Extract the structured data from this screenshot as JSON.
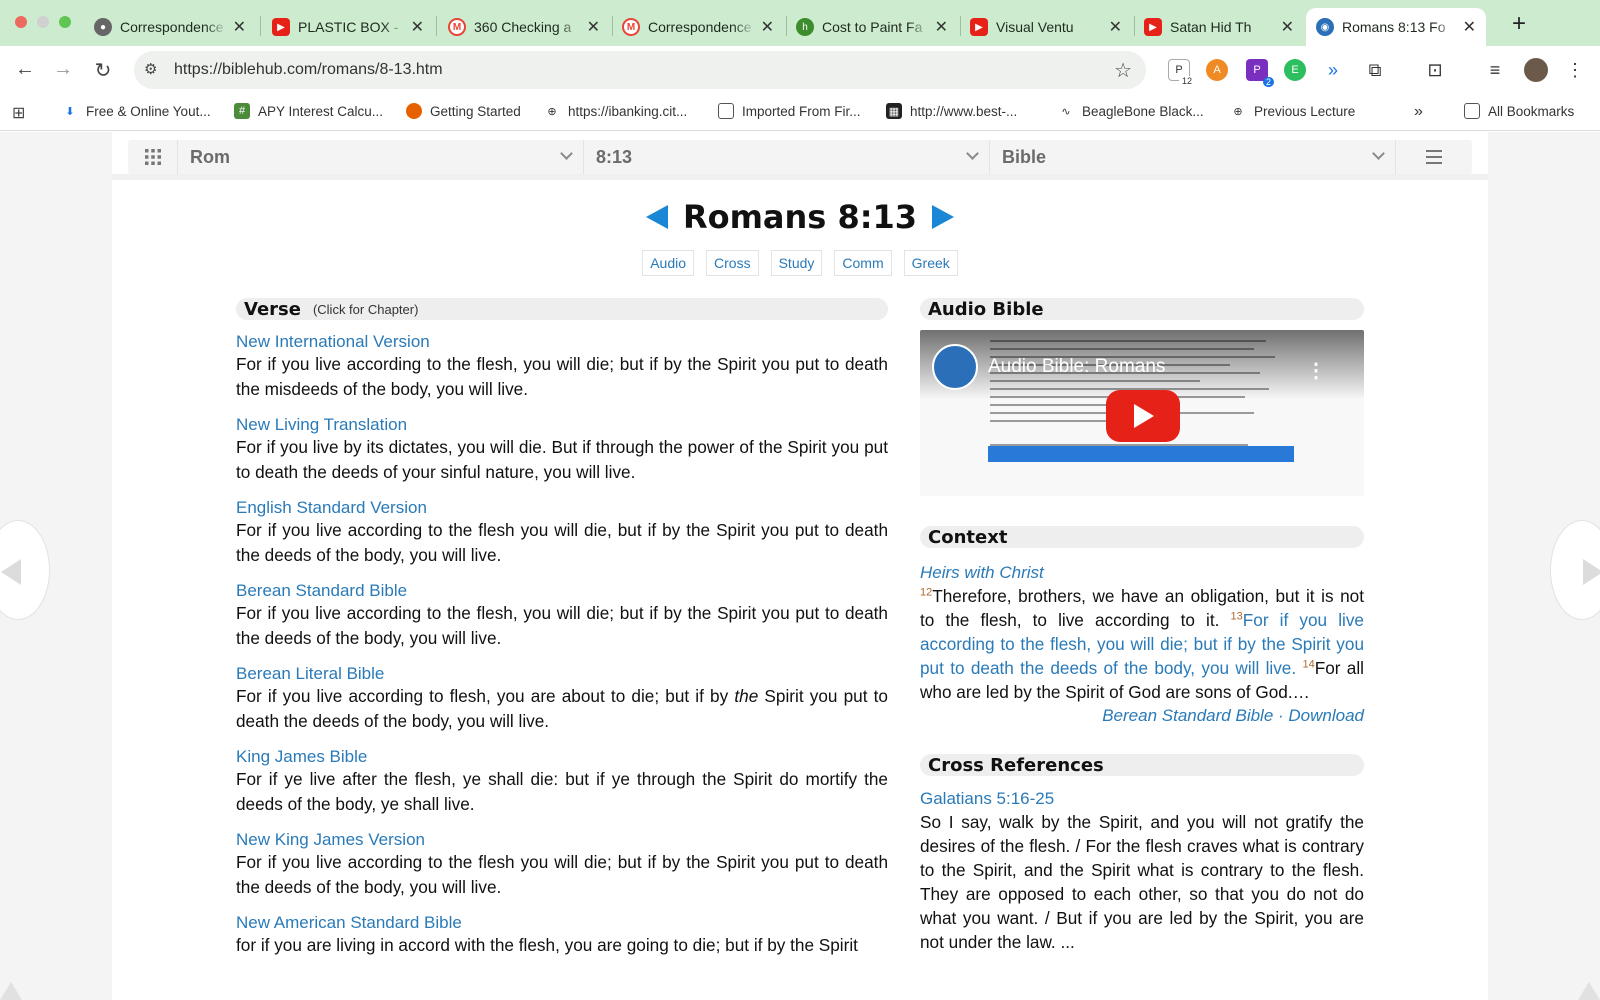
{
  "browser": {
    "tabs": [
      {
        "title": "Correspondence",
        "icon": "globe-icon"
      },
      {
        "title": "PLASTIC BOX -",
        "icon": "youtube-icon"
      },
      {
        "title": "360 Checking a",
        "icon": "gmail-icon"
      },
      {
        "title": "Correspondence",
        "icon": "gmail-icon"
      },
      {
        "title": "Cost to Paint Fa",
        "icon": "homeguide-icon"
      },
      {
        "title": "Visual Ventu",
        "icon": "youtube-icon"
      },
      {
        "title": "Satan Hid Th",
        "icon": "youtube-icon"
      },
      {
        "title": "Romans 8:13 Fo",
        "icon": "biblehub-icon"
      }
    ],
    "url": "https://biblehub.com/romans/8-13.htm",
    "extensions": [
      {
        "icon": "extension-badge-icon",
        "badge": "12"
      },
      {
        "icon": "avast-icon",
        "badge": ""
      },
      {
        "icon": "purple-p-icon",
        "badge": "2"
      },
      {
        "icon": "evernote-icon",
        "badge": ""
      },
      {
        "icon": "audio-wave-icon",
        "badge": ""
      }
    ],
    "bookmarks": [
      {
        "label": "Free & Online Yout...",
        "icon": "download-icon"
      },
      {
        "label": "APY Interest Calcu...",
        "icon": "calculator-icon"
      },
      {
        "label": "Getting Started",
        "icon": "firefox-icon"
      },
      {
        "label": "https://ibanking.cit...",
        "icon": "globe-icon"
      },
      {
        "label": "Imported From Fir...",
        "icon": "folder-icon"
      },
      {
        "label": "http://www.best-...",
        "icon": "site-icon"
      },
      {
        "label": "BeagleBone Black...",
        "icon": "wave-icon"
      },
      {
        "label": "Previous Lecture",
        "icon": "globe-icon"
      }
    ],
    "all_bookmarks": "All Bookmarks",
    "more_bookmarks": "»"
  },
  "selectors": {
    "book": "Rom",
    "verse": "8:13",
    "version": "Bible"
  },
  "header": {
    "title": "Romans 8:13",
    "subnav": [
      "Audio",
      "Cross",
      "Study",
      "Comm",
      "Greek"
    ]
  },
  "verse_section": {
    "title": "Verse",
    "subtitle": "(Click for Chapter)",
    "versions": [
      {
        "name": "New International Version",
        "text": "For if you live according to the flesh, you will die; but if by the Spirit you put to death the misdeeds of the body, you will live."
      },
      {
        "name": "New Living Translation",
        "text": "For if you live by its dictates, you will die. But if through the power of the Spirit you put to death the deeds of your sinful nature, you will live."
      },
      {
        "name": "English Standard Version",
        "text": "For if you live according to the flesh you will die, but if by the Spirit you put to death the deeds of the body, you will live."
      },
      {
        "name": "Berean Standard Bible",
        "text": "For if you live according to the flesh, you will die; but if by the Spirit you put to death the deeds of the body, you will live."
      },
      {
        "name": "Berean Literal Bible",
        "text_before": "For if you live according to flesh, you are about to die; but if by ",
        "text_italic": "the",
        "text_after": " Spirit you put to death the deeds of the body, you will live."
      },
      {
        "name": "King James Bible",
        "text": "For if ye live after the flesh, ye shall die: but if ye through the Spirit do mortify the deeds of the body, ye shall live."
      },
      {
        "name": "New King James Version",
        "text": "For if you live according to the flesh you will die; but if by the Spirit you put to death the deeds of the body, you will live."
      },
      {
        "name": "New American Standard Bible",
        "text": "for if you are living in accord with the flesh, you are going to die; but if by the Spirit"
      }
    ]
  },
  "audio_section": {
    "title": "Audio Bible",
    "video_title": "Audio Bible: Romans"
  },
  "context_section": {
    "title": "Context",
    "heading": "Heirs with Christ",
    "v12_num": "12",
    "v12_text": "Therefore, brothers, we have an obligation, but it is not to the flesh, to live according to it.",
    "v13_num": "13",
    "v13_text": "For if you live according to the flesh, you will die; but if by the Spirit you put to death the deeds of the body, you will live.",
    "v14_num": "14",
    "v14_text": "For all who are led by the Spirit of God are sons of God.…",
    "source": "Berean Standard Bible",
    "separator": " · ",
    "download": "Download"
  },
  "crossref_section": {
    "title": "Cross References",
    "items": [
      {
        "ref": "Galatians 5:16-25",
        "text": "So I say, walk by the Spirit, and you will not gratify the desires of the flesh. / For the flesh craves what is contrary to the Spirit, and the Spirit what is contrary to the flesh. They are opposed to each other, so that you do not do what you want. / But if you are led by the Spirit, you are not under the law. ..."
      }
    ]
  },
  "colors": {
    "tabstrip": "#cdeccf",
    "link": "#2a7ab8",
    "arrow": "#1a86d6",
    "youtube_red": "#e62117"
  }
}
